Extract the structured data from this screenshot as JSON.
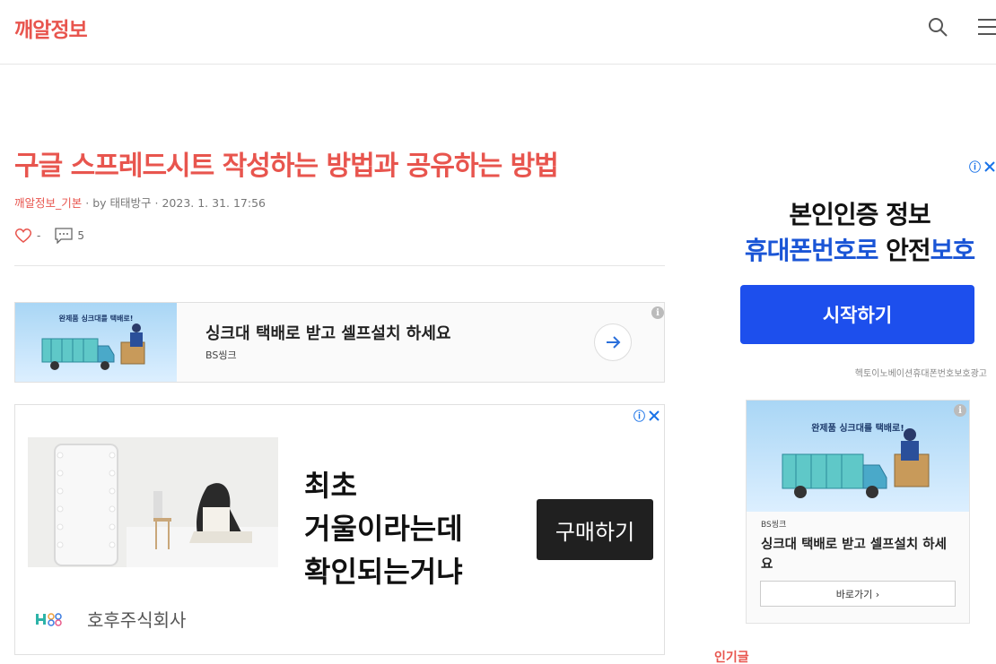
{
  "header": {
    "logo": "깨알정보",
    "icons": [
      "search-icon",
      "menu-icon"
    ]
  },
  "post": {
    "title": "구글 스프레드시트 작성하는 방법과 공유하는 방법",
    "category": "깨알정보_기본",
    "by": "· by",
    "author": "태태방구",
    "date": "· 2023. 1. 31. 17:56",
    "likes": "-",
    "comments": "5"
  },
  "banner_ad": {
    "image_caption": "완제품 싱크대를 택배로!",
    "headline": "싱크대 택배로 받고 셀프설치 하세요",
    "brand": "BS씽크",
    "info": "i"
  },
  "mirror_ad": {
    "text": "최초\n거울이라는데\n확인되는거냐",
    "button": "구매하기",
    "advertiser": "호후주식회사",
    "choices": "ⓘ"
  },
  "side_ad_1": {
    "line1": "본인인증 정보",
    "line2_part1": "휴대폰번호로",
    "line2_part2": " 안전",
    "line2_part3": "보호",
    "button": "시작하기",
    "sponsor": "헥토이노베이션휴대폰번호보호광고",
    "choices": "ⓘ",
    "accent": "#1d4fed"
  },
  "side_ad_2": {
    "image_caption": "완제품 싱크대를 택배로!",
    "brand": "BS씽크",
    "headline": "싱크대 택배로 받고 셀프설치 하세요",
    "button": "바로가기 ›",
    "info": "i"
  },
  "sidebar": {
    "popular_label": "인기글"
  },
  "colors": {
    "brand": "#e8554e",
    "ad_choices": "#1a73e8",
    "text": "#333333"
  }
}
